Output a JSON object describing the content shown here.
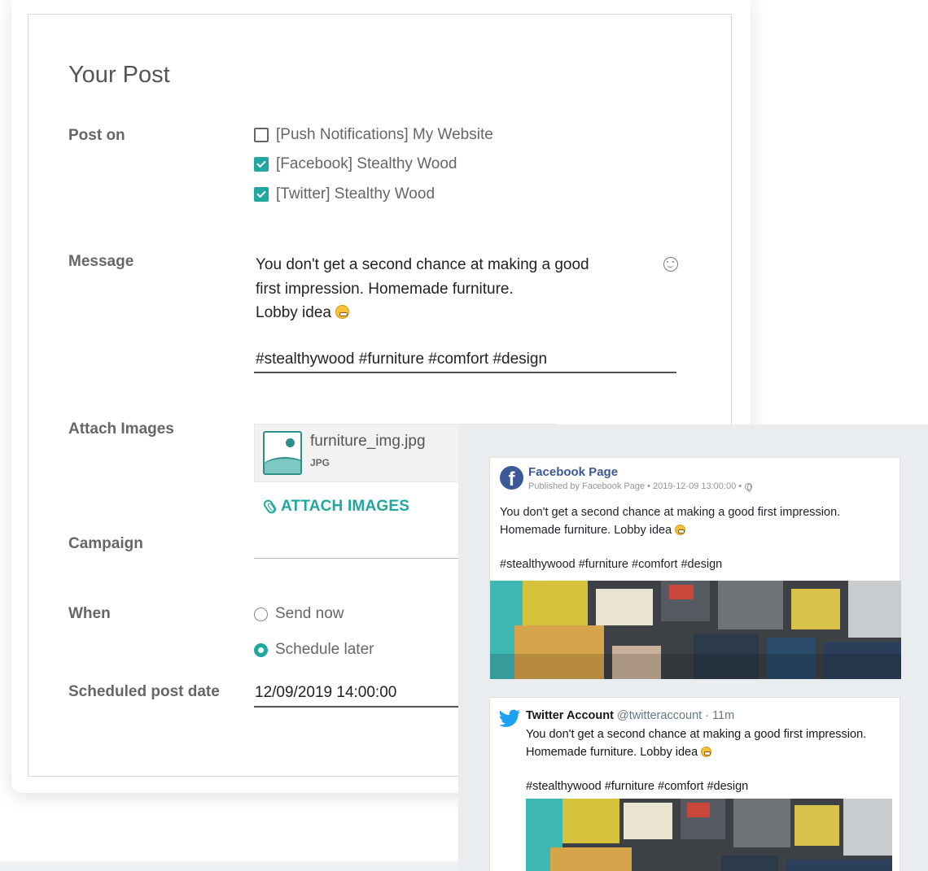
{
  "form": {
    "title": "Your Post",
    "post_on": {
      "label": "Post on",
      "accounts": [
        {
          "label": "[Push Notifications] My Website",
          "checked": false
        },
        {
          "label": "[Facebook] Stealthy Wood",
          "checked": true
        },
        {
          "label": "[Twitter] Stealthy Wood",
          "checked": true
        }
      ]
    },
    "message": {
      "label": "Message",
      "line1": "You don't get a second chance at making a good",
      "line2": "first impression. Homemade furniture.",
      "line3": "Lobby idea",
      "hashtags": "#stealthywood #furniture #comfort #design",
      "emoji_picker_icon": "smiley-icon"
    },
    "attach_images": {
      "label": "Attach Images",
      "file_name": "furniture_img.jpg",
      "file_type": "JPG",
      "button_label": "ATTACH IMAGES"
    },
    "campaign": {
      "label": "Campaign",
      "value": ""
    },
    "when": {
      "label": "When",
      "options": [
        {
          "label": "Send now",
          "selected": false
        },
        {
          "label": "Schedule later",
          "selected": true
        }
      ]
    },
    "scheduled_date": {
      "label": "Scheduled post date",
      "value": "12/09/2019 14:00:00"
    }
  },
  "preview": {
    "facebook": {
      "page_name": "Facebook Page",
      "meta": "Published by Facebook Page • 2019-12-09 13:00:00 •",
      "text": "You don't get a second chance at making a good first impression. Homemade furniture. Lobby idea",
      "hashtags": "#stealthywood #furniture #comfort #design"
    },
    "twitter": {
      "account_name": "Twitter Account",
      "handle": "@twitteraccount · 11m",
      "line1": "You don't get a second chance at making a good first impression.",
      "line2": "Homemade furniture. Lobby idea",
      "hashtags": "#stealthywood #furniture #comfort #design"
    }
  },
  "colors": {
    "accent": "#21a7a0",
    "facebook_blue": "#3b5998",
    "twitter_blue": "#1da1f2",
    "preview_bg": "#e9edf0"
  }
}
